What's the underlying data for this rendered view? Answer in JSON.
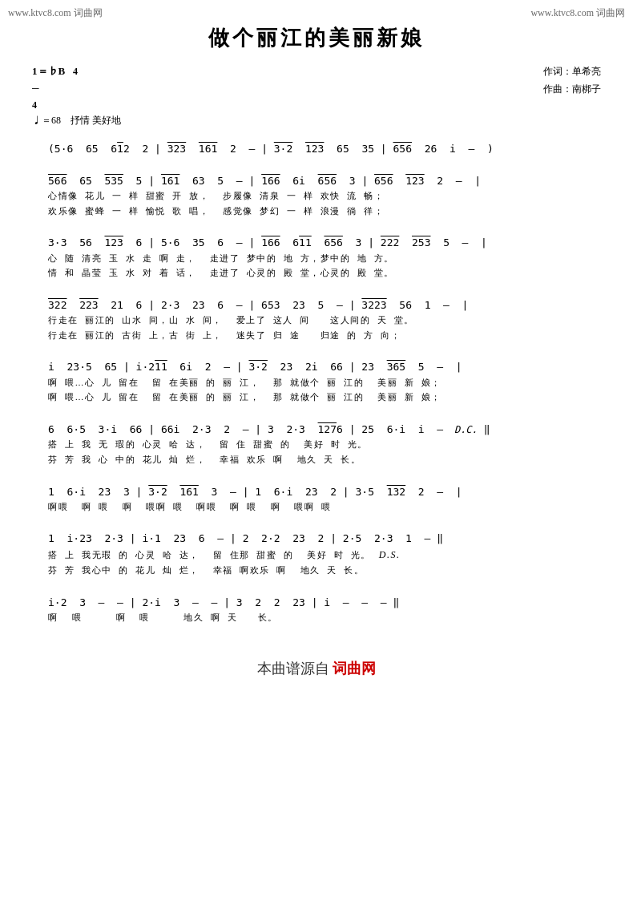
{
  "watermark": {
    "top_left": "www.ktvc8.com 词曲网",
    "top_right": "www.ktvc8.com 词曲网"
  },
  "title": "做个丽江的美丽新娘",
  "meta": {
    "key": "1＝♭B",
    "time": "4/4",
    "tempo": "♩＝68",
    "style": "抒情 美好地",
    "lyricist": "作词：单希亮",
    "composer": "作曲：南梆子"
  },
  "bottom_source": "本曲谱源自",
  "bottom_site": "词曲网"
}
